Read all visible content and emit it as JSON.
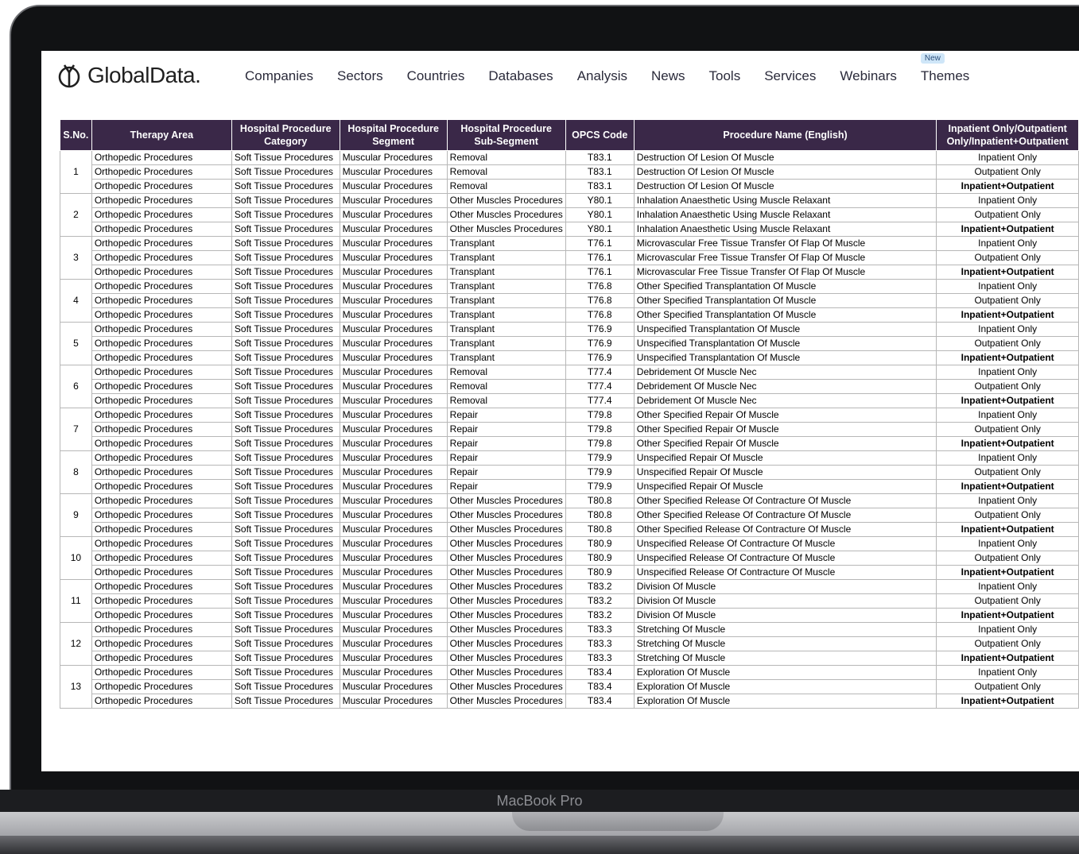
{
  "device": {
    "label": "MacBook Pro"
  },
  "brand": {
    "name": "GlobalData.",
    "accent": "#3a2848"
  },
  "nav": {
    "items": [
      {
        "label": "Companies"
      },
      {
        "label": "Sectors"
      },
      {
        "label": "Countries"
      },
      {
        "label": "Databases"
      },
      {
        "label": "Analysis"
      },
      {
        "label": "News"
      },
      {
        "label": "Tools"
      },
      {
        "label": "Services"
      },
      {
        "label": "Webinars"
      },
      {
        "label": "Themes",
        "badge": "New"
      }
    ]
  },
  "table": {
    "headers": [
      "S.No.",
      "Therapy Area",
      "Hospital Procedure Category",
      "Hospital Procedure Segment",
      "Hospital Procedure Sub-Segment",
      "OPCS Code",
      "Procedure Name (English)",
      "Inpatient Only/Outpatient Only/Inpatient+Outpatient"
    ],
    "statuses": [
      "Inpatient Only",
      "Outpatient Only",
      "Inpatient+Outpatient"
    ],
    "groups": [
      {
        "sno": "1",
        "therapy": "Orthopedic Procedures",
        "category": "Soft Tissue Procedures",
        "segment": "Muscular Procedures",
        "subsegment": "Removal",
        "code": "T83.1",
        "name": "Destruction Of Lesion Of Muscle"
      },
      {
        "sno": "2",
        "therapy": "Orthopedic Procedures",
        "category": "Soft Tissue Procedures",
        "segment": "Muscular Procedures",
        "subsegment": "Other Muscles Procedures",
        "code": "Y80.1",
        "name": "Inhalation Anaesthetic Using Muscle Relaxant"
      },
      {
        "sno": "3",
        "therapy": "Orthopedic Procedures",
        "category": "Soft Tissue Procedures",
        "segment": "Muscular Procedures",
        "subsegment": "Transplant",
        "code": "T76.1",
        "name": "Microvascular Free Tissue Transfer Of Flap Of Muscle"
      },
      {
        "sno": "4",
        "therapy": "Orthopedic Procedures",
        "category": "Soft Tissue Procedures",
        "segment": "Muscular Procedures",
        "subsegment": "Transplant",
        "code": "T76.8",
        "name": "Other Specified Transplantation Of Muscle"
      },
      {
        "sno": "5",
        "therapy": "Orthopedic Procedures",
        "category": "Soft Tissue Procedures",
        "segment": "Muscular Procedures",
        "subsegment": "Transplant",
        "code": "T76.9",
        "name": "Unspecified Transplantation Of Muscle"
      },
      {
        "sno": "6",
        "therapy": "Orthopedic Procedures",
        "category": "Soft Tissue Procedures",
        "segment": "Muscular Procedures",
        "subsegment": "Removal",
        "code": "T77.4",
        "name": "Debridement Of Muscle Nec"
      },
      {
        "sno": "7",
        "therapy": "Orthopedic Procedures",
        "category": "Soft Tissue Procedures",
        "segment": "Muscular Procedures",
        "subsegment": "Repair",
        "code": "T79.8",
        "name": "Other Specified Repair Of Muscle"
      },
      {
        "sno": "8",
        "therapy": "Orthopedic Procedures",
        "category": "Soft Tissue Procedures",
        "segment": "Muscular Procedures",
        "subsegment": "Repair",
        "code": "T79.9",
        "name": "Unspecified Repair Of Muscle"
      },
      {
        "sno": "9",
        "therapy": "Orthopedic Procedures",
        "category": "Soft Tissue Procedures",
        "segment": "Muscular Procedures",
        "subsegment": "Other Muscles Procedures",
        "code": "T80.8",
        "name": "Other Specified Release Of Contracture Of Muscle"
      },
      {
        "sno": "10",
        "therapy": "Orthopedic Procedures",
        "category": "Soft Tissue Procedures",
        "segment": "Muscular Procedures",
        "subsegment": "Other Muscles Procedures",
        "code": "T80.9",
        "name": "Unspecified Release Of Contracture Of Muscle"
      },
      {
        "sno": "11",
        "therapy": "Orthopedic Procedures",
        "category": "Soft Tissue Procedures",
        "segment": "Muscular Procedures",
        "subsegment": "Other Muscles Procedures",
        "code": "T83.2",
        "name": "Division Of Muscle"
      },
      {
        "sno": "12",
        "therapy": "Orthopedic Procedures",
        "category": "Soft Tissue Procedures",
        "segment": "Muscular Procedures",
        "subsegment": "Other Muscles Procedures",
        "code": "T83.3",
        "name": "Stretching Of Muscle"
      },
      {
        "sno": "13",
        "therapy": "Orthopedic Procedures",
        "category": "Soft Tissue Procedures",
        "segment": "Muscular Procedures",
        "subsegment": "Other Muscles Procedures",
        "code": "T83.4",
        "name": "Exploration Of Muscle"
      }
    ]
  }
}
